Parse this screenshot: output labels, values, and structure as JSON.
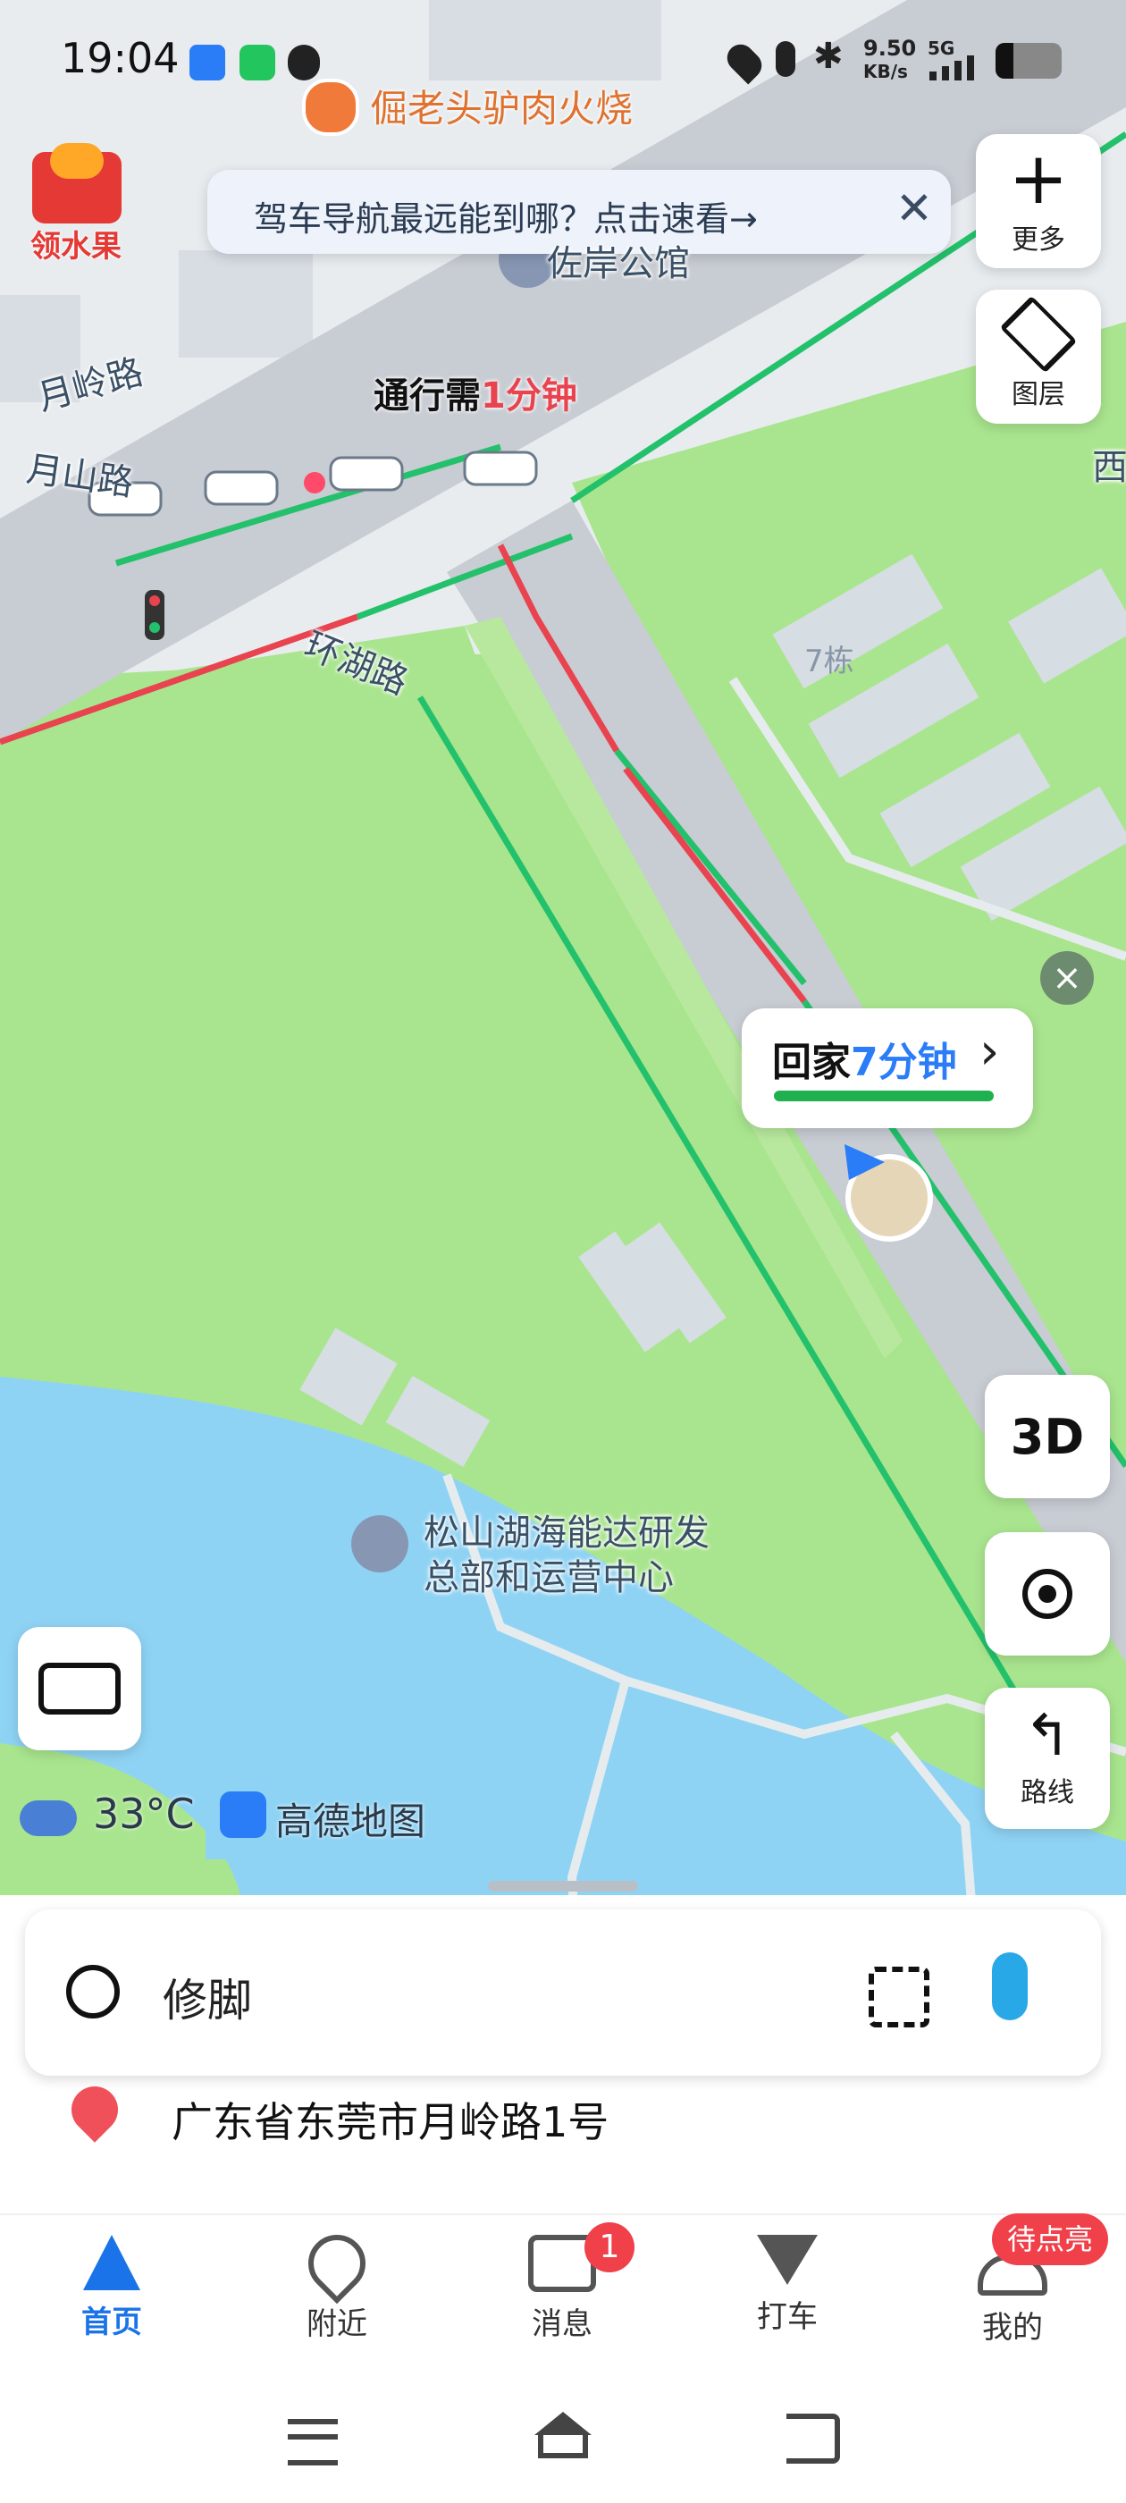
{
  "status_bar": {
    "time": "19:04",
    "speed": "9.50",
    "speed_unit": "KB/s",
    "network": "5G"
  },
  "poi_top": {
    "name": "倔老头驴肉火烧",
    "icon": "fork-knife-icon"
  },
  "promo": {
    "badge": "领水果",
    "banner_text": "驾车导航最远能到哪？点击速看→"
  },
  "map_labels": {
    "building_top": "佐岸公馆",
    "road1": "月岭路",
    "road2": "月山路",
    "road3": "环湖路",
    "block": "7栋",
    "west": "西",
    "campus_line1": "松山湖海能达研发",
    "campus_line2": "总部和运营中心"
  },
  "traffic_tip": {
    "prefix": "通行需",
    "value": "1分钟"
  },
  "home_bubble": {
    "prefix": "回家",
    "value": "7分钟",
    "chevron": "›"
  },
  "right_controls": {
    "more": "更多",
    "layers": "图层",
    "three_d": "3D",
    "route": "路线"
  },
  "weather": {
    "temp": "33°C",
    "brand": "高德地图"
  },
  "search": {
    "query": "修脚"
  },
  "location": {
    "address": "广东省东莞市月岭路1号"
  },
  "bottom_nav": {
    "items": [
      "首页",
      "附近",
      "消息",
      "打车",
      "我的"
    ],
    "message_badge": "1",
    "profile_badge": "待点亮",
    "active_color": "#1a73e8"
  },
  "colors": {
    "park": "#a9e58e",
    "road": "#c8ccd3",
    "water": "#8fd3f4",
    "traffic_green": "#23c16b",
    "traffic_red": "#e8434f",
    "accent": "#2a7cf7"
  }
}
